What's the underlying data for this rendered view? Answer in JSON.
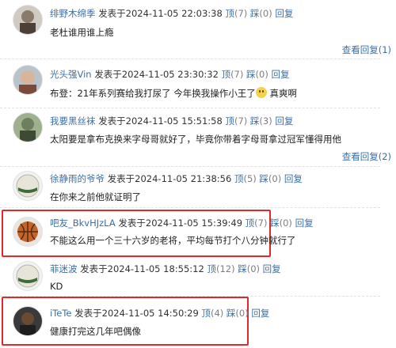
{
  "comments": [
    {
      "user": "绯野木绵季",
      "posted_prefix": "发表于",
      "datetime": "2024-11-05 22:03:38",
      "up_label": "顶",
      "up_count": "(7)",
      "down_label": "踩",
      "down_count": "(0)",
      "reply": "回复",
      "text": "老杜谁用谁上瘾",
      "more_replies": "查看回复(1)"
    },
    {
      "user": "光头强Vin",
      "posted_prefix": "发表于",
      "datetime": "2024-11-05 23:30:32",
      "up_label": "顶",
      "up_count": "(7)",
      "down_label": "踩",
      "down_count": "(0)",
      "reply": "回复",
      "text_before": "布登：21年系列赛给我打尿了 今年换我操作小王了",
      "text_after": "真爽啊"
    },
    {
      "user": "我要黑丝袜",
      "posted_prefix": "发表于",
      "datetime": "2024-11-05 15:51:58",
      "up_label": "顶",
      "up_count": "(7)",
      "down_label": "踩",
      "down_count": "(3)",
      "reply": "回复",
      "text": "太阳要是拿布克换来字母哥就好了，毕竟你带着字母哥拿过冠军懂得用他",
      "more_replies": "查看回复(2)"
    },
    {
      "user": "徐静雨的爷爷",
      "posted_prefix": "发表于",
      "datetime": "2024-11-05 21:38:56",
      "up_label": "顶",
      "up_count": "(5)",
      "down_label": "踩",
      "down_count": "(0)",
      "reply": "回复",
      "text": "在你来之前他就证明了"
    },
    {
      "user": "吧友_BkvHJzLA",
      "posted_prefix": "发表于",
      "datetime": "2024-11-05 15:39:49",
      "up_label": "顶",
      "up_count": "(7)",
      "down_label": "踩",
      "down_count": "(0)",
      "reply": "回复",
      "text": "不能这么用一个三十六岁的老将，平均每节打个八分钟就行了"
    },
    {
      "user": "菲迷波",
      "posted_prefix": "发表于",
      "datetime": "2024-11-05 18:55:12",
      "up_label": "顶",
      "up_count": "(12)",
      "down_label": "踩",
      "down_count": "(0)",
      "reply": "回复",
      "text": "KD"
    },
    {
      "user": "iTeTe",
      "posted_prefix": "发表于",
      "datetime": "2024-11-05 14:50:29",
      "up_label": "顶",
      "up_count": "(4)",
      "down_label": "踩",
      "down_count": "(0)",
      "reply": "回复",
      "text": "健康打完这几年吧偶像"
    }
  ],
  "emoji_icon": "grinning-face-icon",
  "highlight_color": "#dd2a2a",
  "link_color": "#3d6fa5"
}
